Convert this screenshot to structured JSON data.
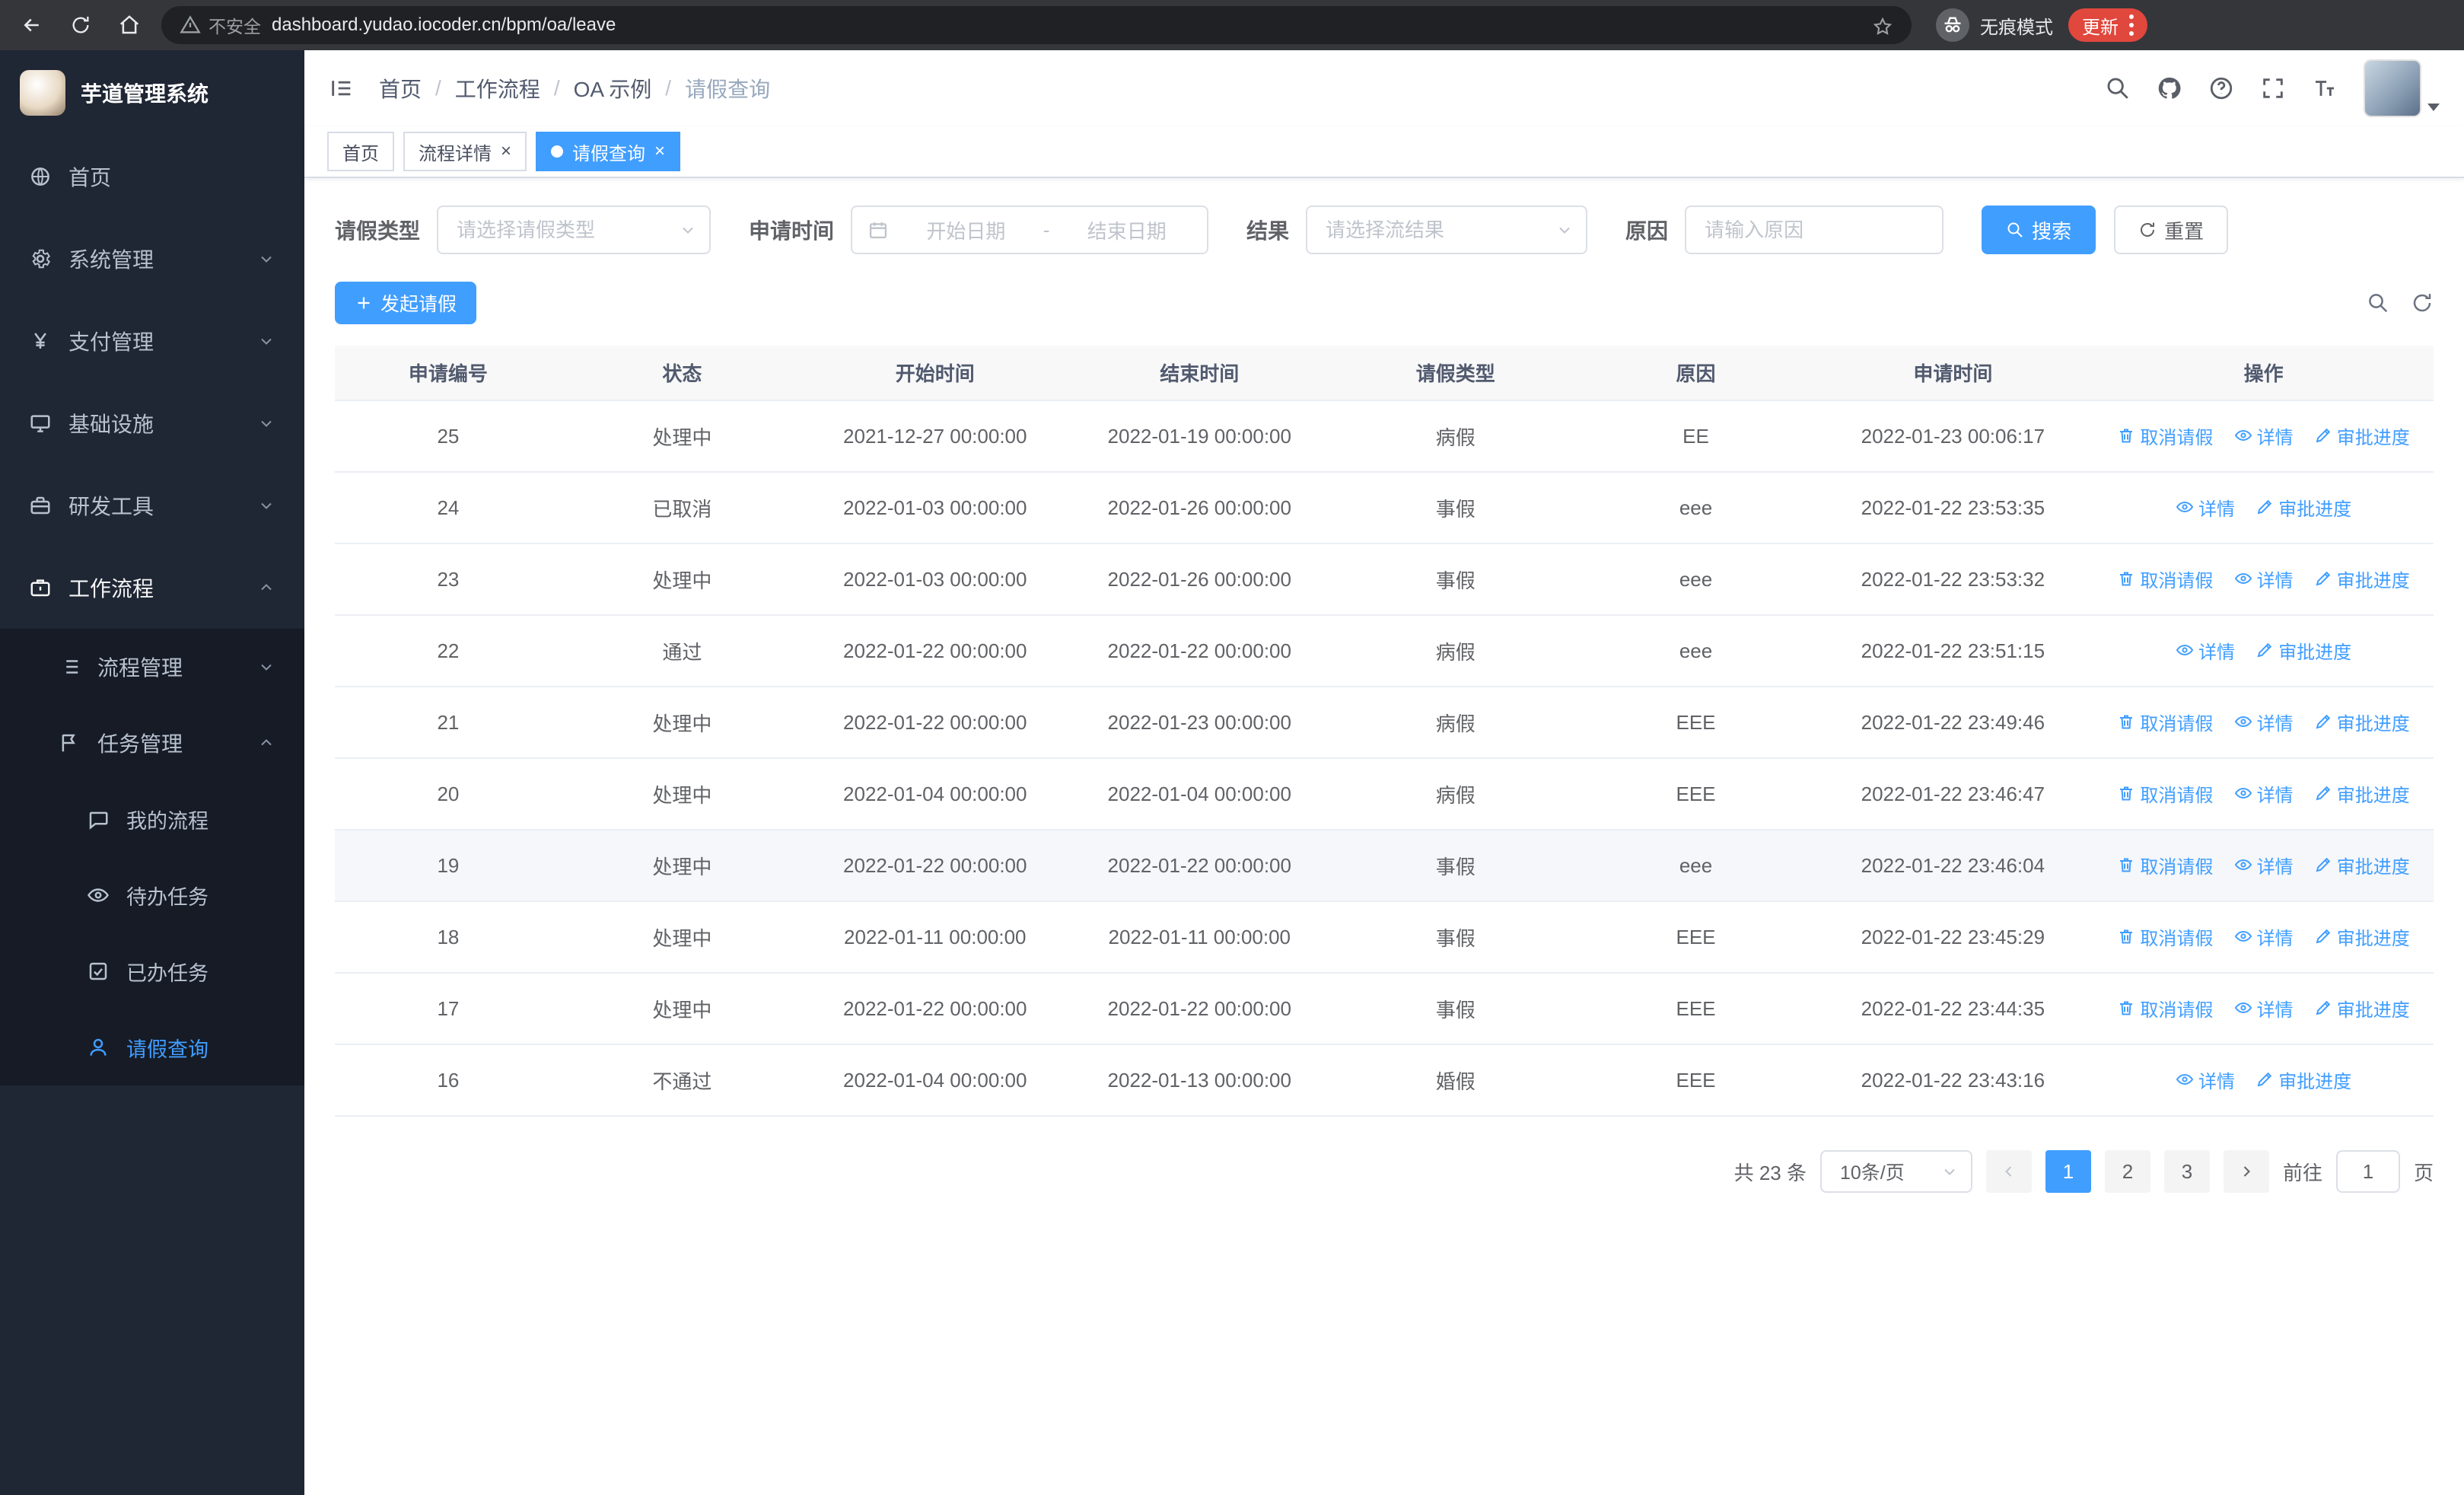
{
  "browser": {
    "security_warning": "不安全",
    "url": "dashboard.yudao.iocoder.cn/bpm/oa/leave",
    "incognito_label": "无痕模式",
    "update_label": "更新"
  },
  "sidebar": {
    "app_title": "芋道管理系统",
    "items": [
      {
        "label": "首页"
      },
      {
        "label": "系统管理"
      },
      {
        "label": "支付管理"
      },
      {
        "label": "基础设施"
      },
      {
        "label": "研发工具"
      },
      {
        "label": "工作流程"
      }
    ],
    "workflow_children": [
      {
        "label": "流程管理"
      },
      {
        "label": "任务管理"
      }
    ],
    "task_children": [
      {
        "label": "我的流程"
      },
      {
        "label": "待办任务"
      },
      {
        "label": "已办任务"
      },
      {
        "label": "请假查询"
      }
    ]
  },
  "header": {
    "breadcrumb": [
      "首页",
      "工作流程",
      "OA 示例",
      "请假查询"
    ],
    "separator": "/"
  },
  "tabs": [
    {
      "label": "首页"
    },
    {
      "label": "流程详情"
    },
    {
      "label": "请假查询"
    }
  ],
  "filters": {
    "leave_type_label": "请假类型",
    "leave_type_placeholder": "请选择请假类型",
    "apply_time_label": "申请时间",
    "start_date_placeholder": "开始日期",
    "date_separator": "-",
    "end_date_placeholder": "结束日期",
    "result_label": "结果",
    "result_placeholder": "请选择流结果",
    "reason_label": "原因",
    "reason_placeholder": "请输入原因",
    "search_button": "搜索",
    "reset_button": "重置"
  },
  "toolbar": {
    "create_button": "发起请假"
  },
  "table": {
    "columns": [
      "申请编号",
      "状态",
      "开始时间",
      "结束时间",
      "请假类型",
      "原因",
      "申请时间",
      "操作"
    ],
    "action_labels": {
      "cancel": "取消请假",
      "detail": "详情",
      "progress": "审批进度"
    },
    "rows": [
      {
        "id": "25",
        "status": "处理中",
        "start": "2021-12-27 00:00:00",
        "end": "2022-01-19 00:00:00",
        "type": "病假",
        "reason": "EE",
        "applied": "2022-01-23 00:06:17"
      },
      {
        "id": "24",
        "status": "已取消",
        "start": "2022-01-03 00:00:00",
        "end": "2022-01-26 00:00:00",
        "type": "事假",
        "reason": "eee",
        "applied": "2022-01-22 23:53:35"
      },
      {
        "id": "23",
        "status": "处理中",
        "start": "2022-01-03 00:00:00",
        "end": "2022-01-26 00:00:00",
        "type": "事假",
        "reason": "eee",
        "applied": "2022-01-22 23:53:32"
      },
      {
        "id": "22",
        "status": "通过",
        "start": "2022-01-22 00:00:00",
        "end": "2022-01-22 00:00:00",
        "type": "病假",
        "reason": "eee",
        "applied": "2022-01-22 23:51:15"
      },
      {
        "id": "21",
        "status": "处理中",
        "start": "2022-01-22 00:00:00",
        "end": "2022-01-23 00:00:00",
        "type": "病假",
        "reason": "EEE",
        "applied": "2022-01-22 23:49:46"
      },
      {
        "id": "20",
        "status": "处理中",
        "start": "2022-01-04 00:00:00",
        "end": "2022-01-04 00:00:00",
        "type": "病假",
        "reason": "EEE",
        "applied": "2022-01-22 23:46:47"
      },
      {
        "id": "19",
        "status": "处理中",
        "start": "2022-01-22 00:00:00",
        "end": "2022-01-22 00:00:00",
        "type": "事假",
        "reason": "eee",
        "applied": "2022-01-22 23:46:04"
      },
      {
        "id": "18",
        "status": "处理中",
        "start": "2022-01-11 00:00:00",
        "end": "2022-01-11 00:00:00",
        "type": "事假",
        "reason": "EEE",
        "applied": "2022-01-22 23:45:29"
      },
      {
        "id": "17",
        "status": "处理中",
        "start": "2022-01-22 00:00:00",
        "end": "2022-01-22 00:00:00",
        "type": "事假",
        "reason": "EEE",
        "applied": "2022-01-22 23:44:35"
      },
      {
        "id": "16",
        "status": "不通过",
        "start": "2022-01-04 00:00:00",
        "end": "2022-01-13 00:00:00",
        "type": "婚假",
        "reason": "EEE",
        "applied": "2022-01-22 23:43:16"
      }
    ]
  },
  "pagination": {
    "total_text": "共 23 条",
    "page_size": "10条/页",
    "pages": [
      "1",
      "2",
      "3"
    ],
    "goto_label": "前往",
    "goto_value": "1",
    "goto_suffix": "页"
  },
  "colors": {
    "primary": "#409eff",
    "sidebar_bg": "#1f2634",
    "submenu_bg": "#161b26",
    "update_red": "#e0473d"
  },
  "icons": [
    "back-icon",
    "forward-icon",
    "refresh-icon",
    "home-icon",
    "warning-icon",
    "star-icon",
    "incognito-icon",
    "menu-dots-icon",
    "hamburger-icon",
    "search-icon",
    "github-icon",
    "help-icon",
    "fullscreen-icon",
    "font-size-icon",
    "calendar-icon",
    "plus-icon",
    "trash-icon",
    "eye-icon",
    "edit-icon"
  ]
}
